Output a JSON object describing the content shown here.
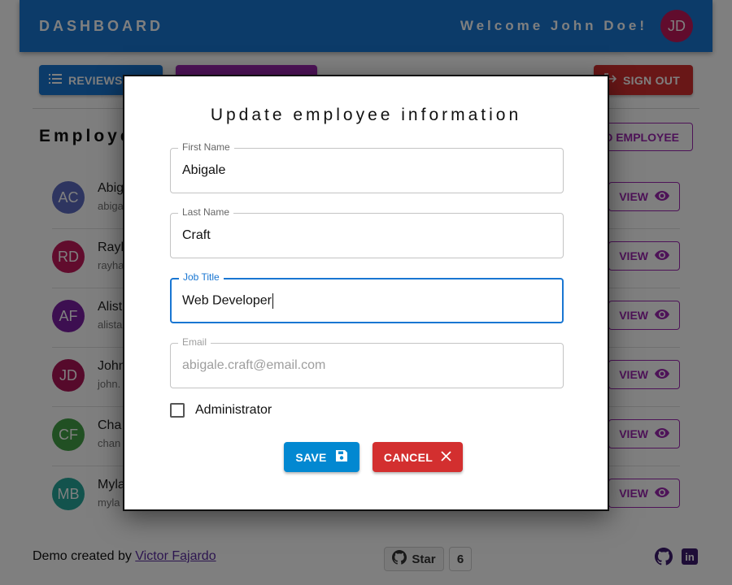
{
  "appbar": {
    "title": "DASHBOARD",
    "welcome": "Welcome John Doe!",
    "avatar_initials": "JD"
  },
  "toolbar": {
    "reviews_label": "REVIEWS",
    "signout_label": "SIGN OUT",
    "add_employee_label": "D EMPLOYEE"
  },
  "section": {
    "title": "Employe"
  },
  "employees": [
    {
      "initials": "AC",
      "name": "Abig",
      "email": "abiga",
      "color": "#5c6bc0",
      "view_label": "VIEW"
    },
    {
      "initials": "RD",
      "name": "Rayh",
      "email": "rayha",
      "color": "#c2185b",
      "view_label": "VIEW"
    },
    {
      "initials": "AF",
      "name": "Alist",
      "email": "alista",
      "color": "#7b1fa2",
      "view_label": "VIEW"
    },
    {
      "initials": "JD",
      "name": "John",
      "email": "john.",
      "color": "#ad1457",
      "view_label": "VIEW"
    },
    {
      "initials": "CF",
      "name": "Cha",
      "email": "chan",
      "color": "#43a047",
      "view_label": "VIEW"
    },
    {
      "initials": "MB",
      "name": "Myla",
      "email": "myla",
      "color": "#26a69a",
      "view_label": "VIEW"
    }
  ],
  "footer": {
    "prefix": "Demo created by ",
    "author": "Victor Fajardo",
    "star_label": "Star",
    "star_count": "6"
  },
  "modal": {
    "title": "Update employee information",
    "fields": {
      "first_name": {
        "label": "First Name",
        "value": "Abigale"
      },
      "last_name": {
        "label": "Last Name",
        "value": "Craft"
      },
      "job_title": {
        "label": "Job Title",
        "value": "Web Developer"
      },
      "email": {
        "label": "Email",
        "value": "abigale.craft@email.com"
      }
    },
    "admin_label": "Administrator",
    "admin_checked": false,
    "save_label": "SAVE",
    "cancel_label": "CANCEL"
  },
  "colors": {
    "primary": "#1976d2",
    "secondary": "#9c27b0",
    "error": "#d32f2f",
    "info": "#0288d1"
  }
}
